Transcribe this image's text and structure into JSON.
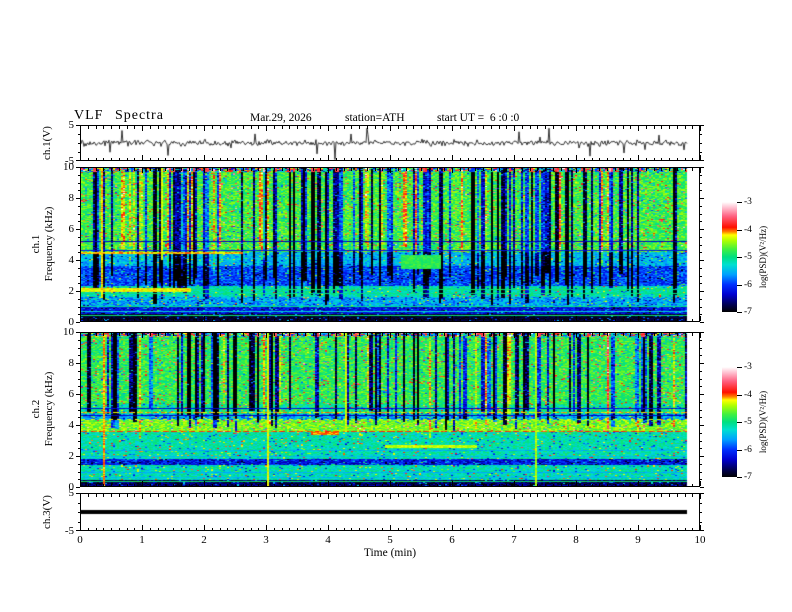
{
  "header": {
    "title": "VLF Spectra",
    "date": "Mar.29, 2026",
    "station": "station=ATH",
    "start_ut": "start UT =  6 :0 :0"
  },
  "x_axis": {
    "label": "Time (min)",
    "min": 0,
    "max": 10,
    "major_ticks": [
      "0",
      "1",
      "2",
      "3",
      "4",
      "5",
      "6",
      "7",
      "8",
      "9",
      "10"
    ],
    "minor_step_min": 0.125,
    "data_end_min": 9.8
  },
  "panels": {
    "ch1_wave": {
      "ylabel": "ch.1(V)",
      "ymin": -5,
      "ymax": 5,
      "ytick_labels": [
        "5",
        "-5"
      ]
    },
    "ch1_spec": {
      "ylabel_line1": "ch.1",
      "ylabel_line2": "Frequency (kHz)",
      "ymin": 0,
      "ymax": 10,
      "ytick_labels": [
        "10",
        "8",
        "6",
        "4",
        "2",
        "0"
      ]
    },
    "ch2_spec": {
      "ylabel_line1": "ch.2",
      "ylabel_line2": "Frequency (kHz)",
      "ymin": 0,
      "ymax": 10,
      "ytick_labels": [
        "10",
        "8",
        "6",
        "4",
        "2",
        "0"
      ]
    },
    "ch3_wave": {
      "ylabel": "ch.3(V)",
      "ymin": -5,
      "ymax": 5,
      "ytick_labels": [
        "5",
        "-5"
      ]
    }
  },
  "colorbar": {
    "label": "log(PSD)(V²/Hz)",
    "tick_labels": [
      "-3",
      "-4",
      "-5",
      "-6",
      "-7"
    ],
    "vmin": -7,
    "vmax": -3,
    "stops": [
      [
        0.0,
        "#000000"
      ],
      [
        0.07,
        "#000055"
      ],
      [
        0.16,
        "#0000d0"
      ],
      [
        0.25,
        "#0030ff"
      ],
      [
        0.34,
        "#00a0ff"
      ],
      [
        0.43,
        "#00e0d0"
      ],
      [
        0.5,
        "#00e080"
      ],
      [
        0.57,
        "#40f040"
      ],
      [
        0.65,
        "#b0ff00"
      ],
      [
        0.7,
        "#ffff00"
      ],
      [
        0.73,
        "#ff8000"
      ],
      [
        0.77,
        "#ff1000"
      ],
      [
        0.87,
        "#ff6080"
      ],
      [
        0.94,
        "#ffb6c8"
      ],
      [
        1.0,
        "#ffffff"
      ]
    ]
  },
  "chart_data": [
    {
      "type": "line",
      "name": "ch.1 voltage waveform",
      "xlabel": "Time (min)",
      "ylabel": "ch.1(V)",
      "xlim": [
        0,
        10
      ],
      "ylim": [
        -5,
        5
      ],
      "x_data_end": 9.8,
      "signal": {
        "mean_v": 0,
        "noise_sigma_v": 0.5,
        "spike_amplitude_v": [
          -5,
          5
        ],
        "character": "broadband noise about 0 V with frequent impulsive spikes, mostly downward, clipped at ±5 V"
      }
    },
    {
      "type": "heatmap",
      "name": "ch.1 spectrogram",
      "xlabel": "Time (min)",
      "ylabel": "Frequency (kHz)",
      "zlabel": "log(PSD)(V²/Hz)",
      "xlim": [
        0,
        10
      ],
      "ylim": [
        0,
        10
      ],
      "zlim": [
        -7,
        -3
      ],
      "x_data_end": 9.8,
      "bands": [
        {
          "f": [
            9.75,
            10
          ],
          "level": -5.0,
          "noise": 1.3
        },
        {
          "f": [
            4.5,
            9.75
          ],
          "level": -4.75,
          "noise": 0.35
        },
        {
          "f": [
            3.6,
            4.5
          ],
          "level": -5.5,
          "noise": 0.3
        },
        {
          "f": [
            2.3,
            3.6
          ],
          "level": -5.95,
          "noise": 0.35
        },
        {
          "f": [
            1.55,
            2.3
          ],
          "level": -5.15,
          "noise": 0.3
        },
        {
          "f": [
            0.95,
            1.55
          ],
          "level": -5.6,
          "noise": 0.35
        },
        {
          "f": [
            0.45,
            0.95
          ],
          "level": -6.25,
          "noise": 0.3
        },
        {
          "f": [
            0,
            0.45
          ],
          "level": -6.85,
          "noise": 0.15
        }
      ],
      "hlines": [
        {
          "f": 5.2,
          "v": -6.4
        },
        {
          "f": 4.62,
          "v": -6.2
        },
        {
          "f": 2.05,
          "v": -4.95
        },
        {
          "f": 1.75,
          "v": -5.0
        },
        {
          "f": 0.95,
          "v": -5.05
        },
        {
          "f": 0.62,
          "v": -5.3
        },
        {
          "f": 0.3,
          "v": -4.95
        }
      ],
      "patches": [
        {
          "x": [
            0,
            1.75
          ],
          "f": [
            1.9,
            2.12
          ],
          "v": -4.25
        },
        {
          "x": [
            0,
            2.6
          ],
          "f": [
            4.36,
            4.48
          ],
          "v": -4.15
        },
        {
          "x": [
            5.15,
            5.8
          ],
          "f": [
            3.4,
            4.3
          ],
          "v": -4.8
        }
      ],
      "vlines": [
        {
          "x": 0.33,
          "f": [
            1.5,
            10
          ],
          "v": -4.2
        },
        {
          "x": 1.28,
          "f": [
            4,
            10
          ],
          "v": -4.3
        }
      ],
      "stripes": {
        "dark_count": 105,
        "dark_depth": [
          1.1,
          2.7
        ],
        "dark_fmin": [
          0.9,
          3.2
        ],
        "bright_count": 26,
        "bright_boost": [
          0.4,
          0.9
        ],
        "red_top_fraction": 0.3
      },
      "top_speckle": true
    },
    {
      "type": "heatmap",
      "name": "ch.2 spectrogram",
      "xlabel": "Time (min)",
      "ylabel": "Frequency (kHz)",
      "zlabel": "log(PSD)(V²/Hz)",
      "xlim": [
        0,
        10
      ],
      "ylim": [
        0,
        10
      ],
      "zlim": [
        -7,
        -3
      ],
      "x_data_end": 9.8,
      "bands": [
        {
          "f": [
            9.75,
            10
          ],
          "level": -4.9,
          "noise": 0.9
        },
        {
          "f": [
            5.35,
            9.75
          ],
          "level": -4.8,
          "noise": 0.32
        },
        {
          "f": [
            4.7,
            5.35
          ],
          "level": -5.05,
          "noise": 0.35
        },
        {
          "f": [
            4.3,
            4.7
          ],
          "level": -5.6,
          "noise": 0.4
        },
        {
          "f": [
            3.55,
            4.3
          ],
          "level": -4.55,
          "noise": 0.28
        },
        {
          "f": [
            1.75,
            3.55
          ],
          "level": -5.15,
          "noise": 0.28
        },
        {
          "f": [
            1.35,
            1.75
          ],
          "level": -6.2,
          "noise": 0.4
        },
        {
          "f": [
            0.38,
            1.35
          ],
          "level": -5.2,
          "noise": 0.3
        },
        {
          "f": [
            0,
            0.38
          ],
          "level": -6.7,
          "noise": 0.3
        }
      ],
      "hlines": [
        {
          "f": 5.05,
          "v": -6.3
        },
        {
          "f": 4.82,
          "v": -4.15,
          "dash": [
            5,
            3
          ]
        },
        {
          "f": 4.62,
          "v": -6.4
        },
        {
          "f": 4.35,
          "v": -4.3,
          "dash": [
            4,
            5
          ]
        },
        {
          "f": 3.52,
          "v": -3.95,
          "dash": [
            6,
            3
          ]
        },
        {
          "f": 2.3,
          "v": -5.55
        },
        {
          "f": 1.9,
          "v": -5.5
        },
        {
          "f": 0.85,
          "v": -5.55
        },
        {
          "f": 0.55,
          "v": -5.5
        },
        {
          "f": 0.28,
          "v": -4.95
        }
      ],
      "patches": [
        {
          "x": [
            4.9,
            6.4
          ],
          "f": [
            2.5,
            2.64
          ],
          "v": -4.35
        },
        {
          "x": [
            3.7,
            4.15
          ],
          "f": [
            3.3,
            3.55
          ],
          "v": -4.1
        }
      ],
      "vlines": [
        {
          "x": 0.35,
          "f": [
            0,
            10
          ],
          "v": -4.1
        },
        {
          "x": 3.0,
          "f": [
            0,
            10
          ],
          "v": -4.3
        },
        {
          "x": 4.27,
          "f": [
            3.5,
            10
          ],
          "v": -4.3
        },
        {
          "x": 7.35,
          "f": [
            0,
            10
          ],
          "v": -4.4
        }
      ],
      "stripes": {
        "dark_count": 92,
        "dark_depth": [
          1.1,
          2.8
        ],
        "dark_fmin": [
          3.6,
          5.0
        ],
        "bright_count": 20,
        "bright_boost": [
          0.4,
          0.8
        ],
        "red_top_fraction": 0.15
      },
      "top_speckle": true
    },
    {
      "type": "line",
      "name": "ch.3 voltage waveform",
      "xlabel": "Time (min)",
      "ylabel": "ch.3(V)",
      "xlim": [
        0,
        10
      ],
      "ylim": [
        -5,
        5
      ],
      "x_data_end": 9.8,
      "signal": {
        "constant_v": 0,
        "character": "flat thick line at 0 V for entire record"
      }
    }
  ]
}
